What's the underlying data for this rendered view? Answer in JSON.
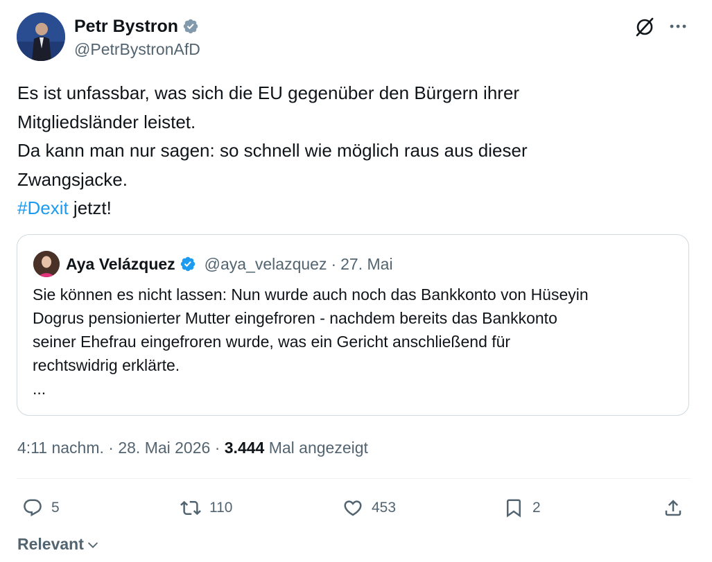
{
  "author": {
    "name": "Petr Bystron",
    "handle": "@PetrBystronAfD",
    "verified": true,
    "avatar_icon": "profile-photo"
  },
  "header_icons": [
    "grok-icon",
    "more-options-icon"
  ],
  "tweet": {
    "line1": "Es ist unfassbar, was sich die EU gegenüber den Bürgern ihrer",
    "line2": "Mitgliedsländer leistet.",
    "line3": "Da kann man nur sagen: so schnell  wie möglich raus aus dieser",
    "line4": "Zwangsjacke.",
    "hashtag": "#Dexit",
    "line5_rest": " jetzt!"
  },
  "quote": {
    "name": "Aya Velázquez",
    "handle": "@aya_velazquez",
    "separator": "·",
    "date": "27. Mai",
    "line1": "Sie können es nicht lassen: Nun wurde auch noch das Bankkonto von Hüseyin",
    "line2": "Dogrus pensionierter Mutter eingefroren - nachdem bereits das Bankkonto",
    "line3": "seiner Ehefrau eingefroren wurde, was ein Gericht anschließend für",
    "line4": "rechtswidrig erklärte.",
    "ellipsis": "..."
  },
  "meta": {
    "time": "4:11 nachm.",
    "sep1": " · ",
    "date": "28. Mai 2026",
    "sep2": " · ",
    "views": "3.444",
    "views_label": " Mal angezeigt"
  },
  "actions": {
    "replies": "5",
    "reposts": "110",
    "likes": "453",
    "bookmarks": "2"
  },
  "sort": {
    "label": "Relevant"
  },
  "colors": {
    "link": "#1d9bf0",
    "text": "#0f1419",
    "muted": "#536471",
    "border": "#cfd9de"
  }
}
